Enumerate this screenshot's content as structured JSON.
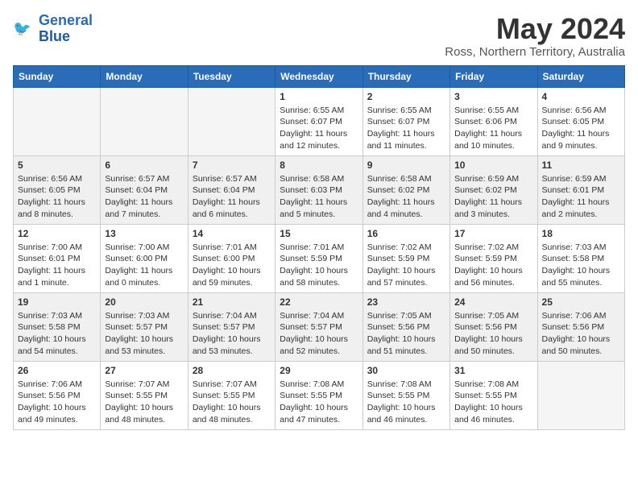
{
  "header": {
    "logo_line1": "General",
    "logo_line2": "Blue",
    "month_year": "May 2024",
    "location": "Ross, Northern Territory, Australia"
  },
  "days_of_week": [
    "Sunday",
    "Monday",
    "Tuesday",
    "Wednesday",
    "Thursday",
    "Friday",
    "Saturday"
  ],
  "weeks": [
    [
      {
        "num": "",
        "info": ""
      },
      {
        "num": "",
        "info": ""
      },
      {
        "num": "",
        "info": ""
      },
      {
        "num": "1",
        "info": "Sunrise: 6:55 AM\nSunset: 6:07 PM\nDaylight: 11 hours and 12 minutes."
      },
      {
        "num": "2",
        "info": "Sunrise: 6:55 AM\nSunset: 6:07 PM\nDaylight: 11 hours and 11 minutes."
      },
      {
        "num": "3",
        "info": "Sunrise: 6:55 AM\nSunset: 6:06 PM\nDaylight: 11 hours and 10 minutes."
      },
      {
        "num": "4",
        "info": "Sunrise: 6:56 AM\nSunset: 6:05 PM\nDaylight: 11 hours and 9 minutes."
      }
    ],
    [
      {
        "num": "5",
        "info": "Sunrise: 6:56 AM\nSunset: 6:05 PM\nDaylight: 11 hours and 8 minutes."
      },
      {
        "num": "6",
        "info": "Sunrise: 6:57 AM\nSunset: 6:04 PM\nDaylight: 11 hours and 7 minutes."
      },
      {
        "num": "7",
        "info": "Sunrise: 6:57 AM\nSunset: 6:04 PM\nDaylight: 11 hours and 6 minutes."
      },
      {
        "num": "8",
        "info": "Sunrise: 6:58 AM\nSunset: 6:03 PM\nDaylight: 11 hours and 5 minutes."
      },
      {
        "num": "9",
        "info": "Sunrise: 6:58 AM\nSunset: 6:02 PM\nDaylight: 11 hours and 4 minutes."
      },
      {
        "num": "10",
        "info": "Sunrise: 6:59 AM\nSunset: 6:02 PM\nDaylight: 11 hours and 3 minutes."
      },
      {
        "num": "11",
        "info": "Sunrise: 6:59 AM\nSunset: 6:01 PM\nDaylight: 11 hours and 2 minutes."
      }
    ],
    [
      {
        "num": "12",
        "info": "Sunrise: 7:00 AM\nSunset: 6:01 PM\nDaylight: 11 hours and 1 minute."
      },
      {
        "num": "13",
        "info": "Sunrise: 7:00 AM\nSunset: 6:00 PM\nDaylight: 11 hours and 0 minutes."
      },
      {
        "num": "14",
        "info": "Sunrise: 7:01 AM\nSunset: 6:00 PM\nDaylight: 10 hours and 59 minutes."
      },
      {
        "num": "15",
        "info": "Sunrise: 7:01 AM\nSunset: 5:59 PM\nDaylight: 10 hours and 58 minutes."
      },
      {
        "num": "16",
        "info": "Sunrise: 7:02 AM\nSunset: 5:59 PM\nDaylight: 10 hours and 57 minutes."
      },
      {
        "num": "17",
        "info": "Sunrise: 7:02 AM\nSunset: 5:59 PM\nDaylight: 10 hours and 56 minutes."
      },
      {
        "num": "18",
        "info": "Sunrise: 7:03 AM\nSunset: 5:58 PM\nDaylight: 10 hours and 55 minutes."
      }
    ],
    [
      {
        "num": "19",
        "info": "Sunrise: 7:03 AM\nSunset: 5:58 PM\nDaylight: 10 hours and 54 minutes."
      },
      {
        "num": "20",
        "info": "Sunrise: 7:03 AM\nSunset: 5:57 PM\nDaylight: 10 hours and 53 minutes."
      },
      {
        "num": "21",
        "info": "Sunrise: 7:04 AM\nSunset: 5:57 PM\nDaylight: 10 hours and 53 minutes."
      },
      {
        "num": "22",
        "info": "Sunrise: 7:04 AM\nSunset: 5:57 PM\nDaylight: 10 hours and 52 minutes."
      },
      {
        "num": "23",
        "info": "Sunrise: 7:05 AM\nSunset: 5:56 PM\nDaylight: 10 hours and 51 minutes."
      },
      {
        "num": "24",
        "info": "Sunrise: 7:05 AM\nSunset: 5:56 PM\nDaylight: 10 hours and 50 minutes."
      },
      {
        "num": "25",
        "info": "Sunrise: 7:06 AM\nSunset: 5:56 PM\nDaylight: 10 hours and 50 minutes."
      }
    ],
    [
      {
        "num": "26",
        "info": "Sunrise: 7:06 AM\nSunset: 5:56 PM\nDaylight: 10 hours and 49 minutes."
      },
      {
        "num": "27",
        "info": "Sunrise: 7:07 AM\nSunset: 5:55 PM\nDaylight: 10 hours and 48 minutes."
      },
      {
        "num": "28",
        "info": "Sunrise: 7:07 AM\nSunset: 5:55 PM\nDaylight: 10 hours and 48 minutes."
      },
      {
        "num": "29",
        "info": "Sunrise: 7:08 AM\nSunset: 5:55 PM\nDaylight: 10 hours and 47 minutes."
      },
      {
        "num": "30",
        "info": "Sunrise: 7:08 AM\nSunset: 5:55 PM\nDaylight: 10 hours and 46 minutes."
      },
      {
        "num": "31",
        "info": "Sunrise: 7:08 AM\nSunset: 5:55 PM\nDaylight: 10 hours and 46 minutes."
      },
      {
        "num": "",
        "info": ""
      }
    ]
  ]
}
